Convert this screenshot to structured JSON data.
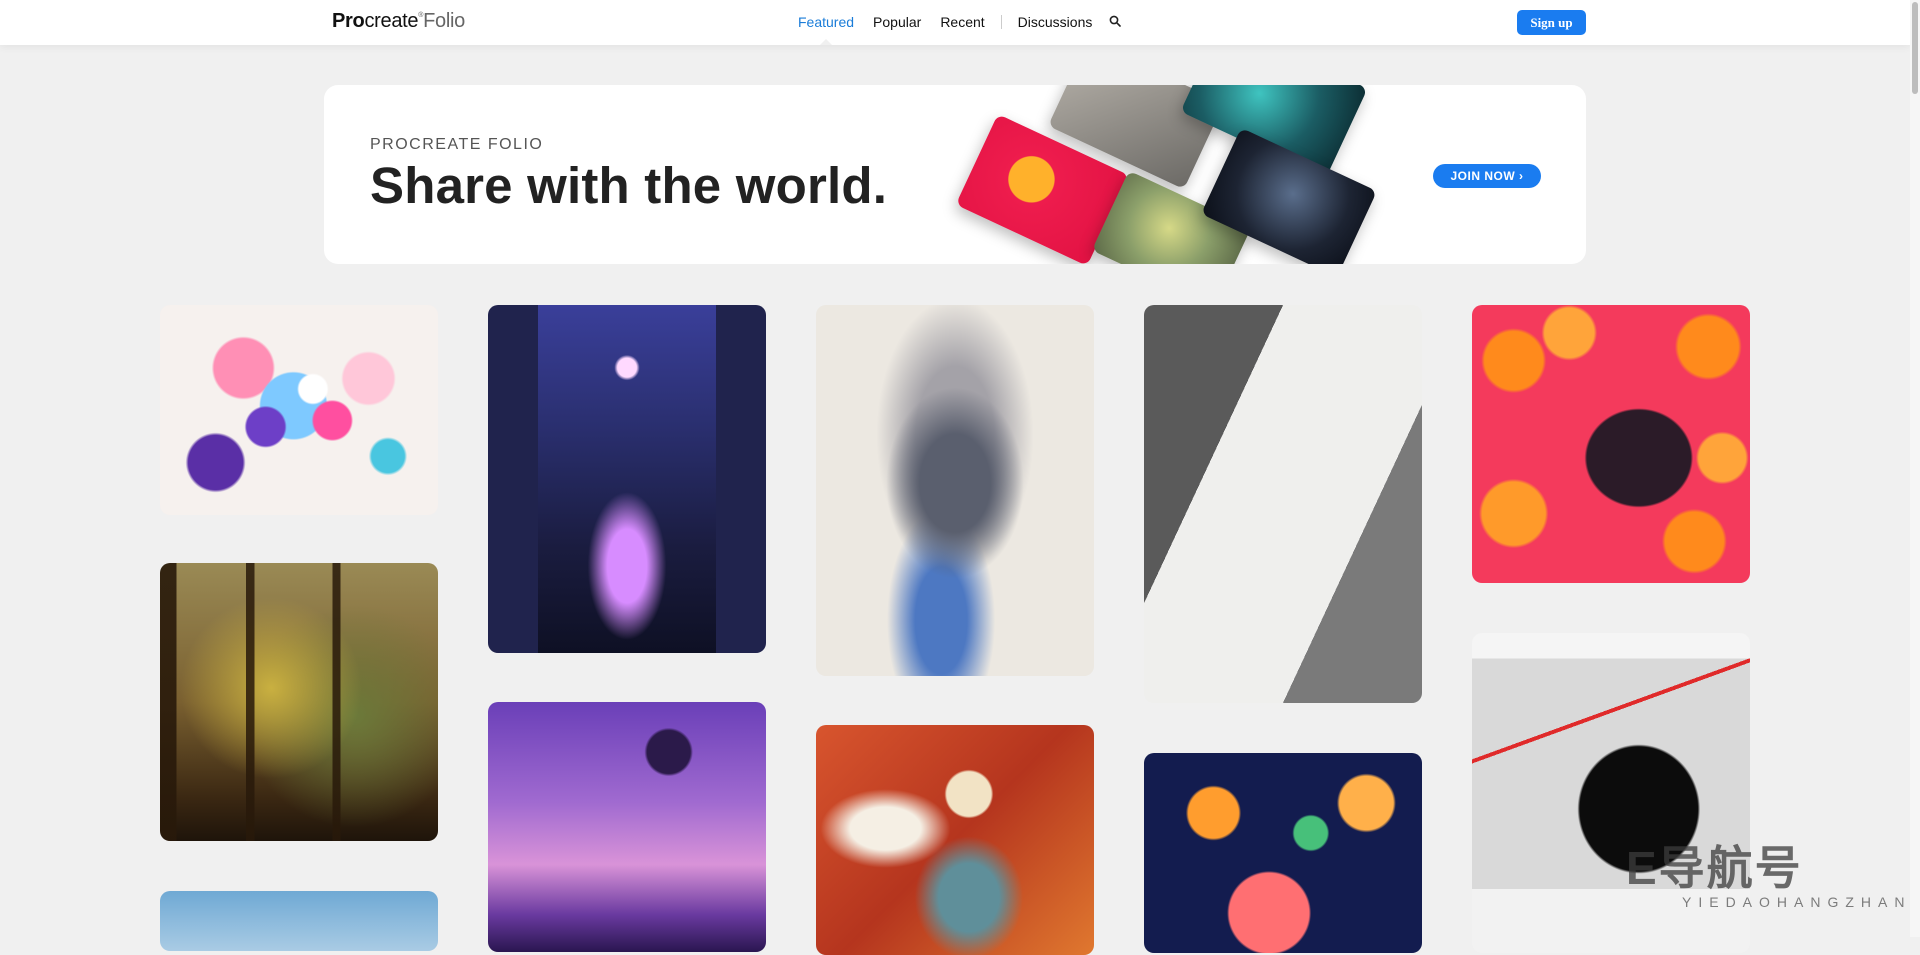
{
  "header": {
    "logo_pro": "Pro",
    "logo_create": "create",
    "logo_folio": "Folio",
    "nav": {
      "featured": "Featured",
      "popular": "Popular",
      "recent": "Recent",
      "discussions": "Discussions"
    },
    "signup_label": "Sign up"
  },
  "banner": {
    "eyebrow": "PROCREATE FOLIO",
    "headline": "Share with the world.",
    "join_label": "JOIN NOW ›"
  },
  "watermark": {
    "mark": "E导航号",
    "sub": "YIEDAOHANGZHAN"
  },
  "colors": {
    "accent": "#1a7cf0",
    "active_nav": "#1a7cd8",
    "page_bg": "#f0f0f0"
  },
  "icons": {
    "search": "search-icon",
    "scroll": "scrollbar"
  }
}
